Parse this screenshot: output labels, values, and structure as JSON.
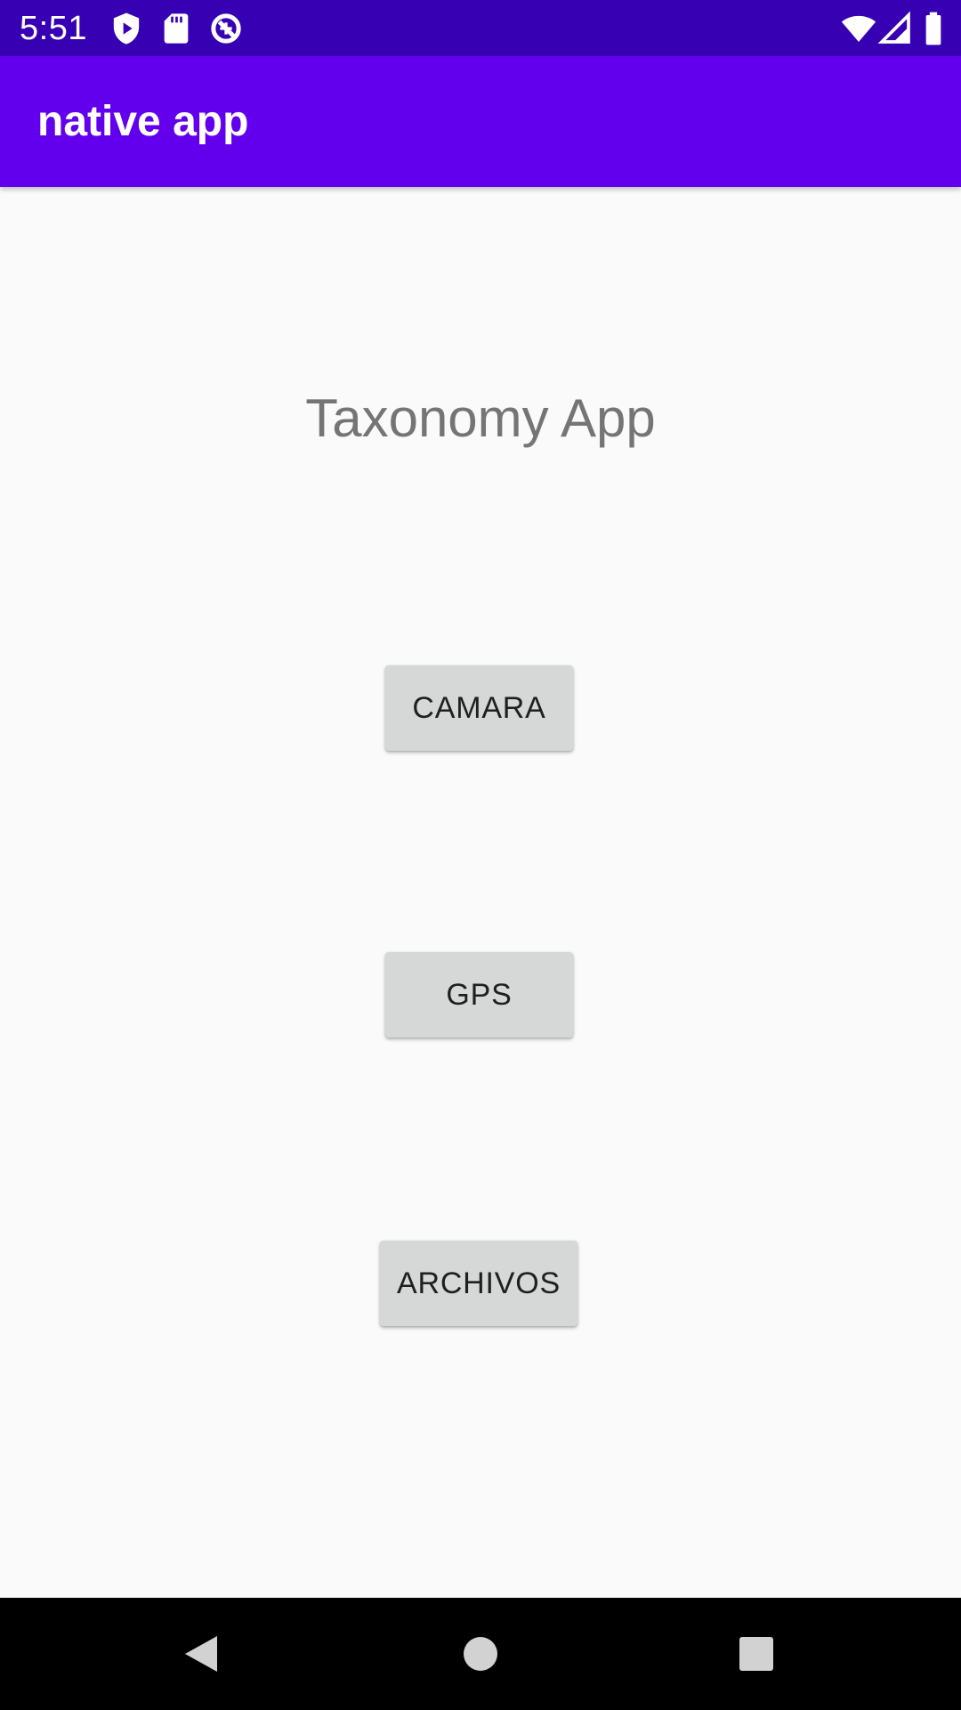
{
  "status_bar": {
    "time": "5:51",
    "left_icons": [
      "shield-play-icon",
      "sd-card-icon",
      "data-saver-icon"
    ],
    "right_icons": [
      "wifi-icon",
      "signal-icon",
      "battery-icon"
    ]
  },
  "app_bar": {
    "title": "native app"
  },
  "main": {
    "heading": "Taxonomy App",
    "buttons": {
      "camara": "CAMARA",
      "gps": "GPS",
      "archivos": "ARCHIVOS"
    }
  },
  "nav_bar": {
    "icons": [
      "back-icon",
      "home-icon",
      "recents-icon"
    ]
  },
  "colors": {
    "status_bar": "#3700b3",
    "app_bar": "#6200ee",
    "background": "#fafafa",
    "button": "#d6d7d7",
    "heading_text": "#757575",
    "nav_bar": "#000000"
  }
}
